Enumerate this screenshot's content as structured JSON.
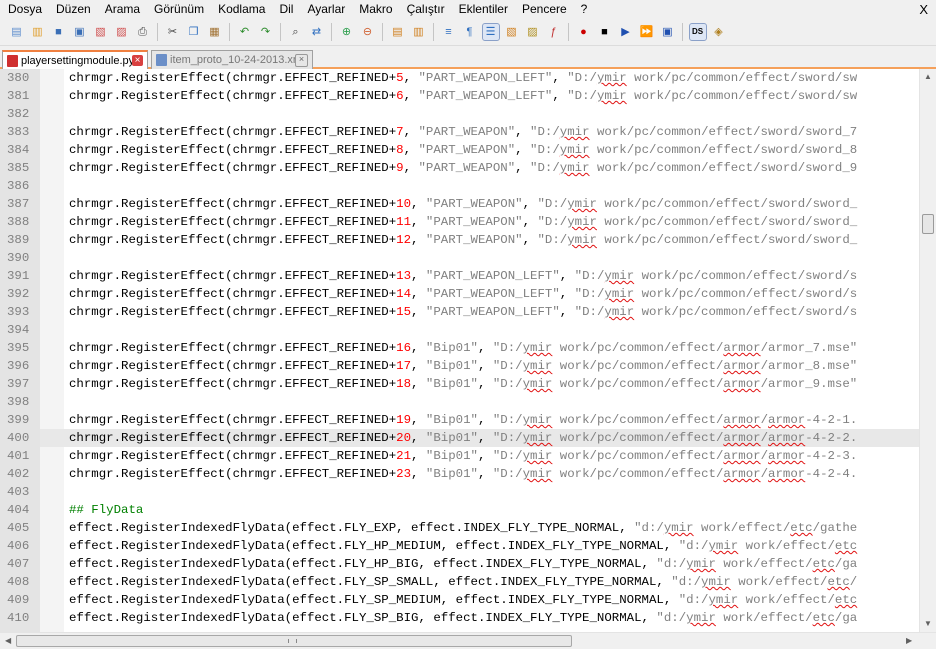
{
  "menu": [
    "Dosya",
    "Düzen",
    "Arama",
    "Görünüm",
    "Kodlama",
    "Dil",
    "Ayarlar",
    "Makro",
    "Çalıştır",
    "Eklentiler",
    "Pencere",
    "?"
  ],
  "window": {
    "close_glyph": "X"
  },
  "toolbar": {
    "icons": [
      {
        "name": "new-file-icon",
        "glyph": "▤",
        "color": "#5b8ccd"
      },
      {
        "name": "open-file-icon",
        "glyph": "▥",
        "color": "#e0a030"
      },
      {
        "name": "save-icon",
        "glyph": "■",
        "color": "#3b6fb6"
      },
      {
        "name": "save-all-icon",
        "glyph": "▣",
        "color": "#3b6fb6"
      },
      {
        "name": "close-file-icon",
        "glyph": "▧",
        "color": "#d05050"
      },
      {
        "name": "close-all-icon",
        "glyph": "▨",
        "color": "#d05050"
      },
      {
        "name": "print-icon",
        "glyph": "⎙",
        "color": "#505050"
      },
      {
        "sep": true
      },
      {
        "name": "cut-icon",
        "glyph": "✂",
        "color": "#404040"
      },
      {
        "name": "copy-icon",
        "glyph": "❐",
        "color": "#3070c0"
      },
      {
        "name": "paste-icon",
        "glyph": "▦",
        "color": "#a07030"
      },
      {
        "sep": true
      },
      {
        "name": "undo-icon",
        "glyph": "↶",
        "color": "#2a8a2a"
      },
      {
        "name": "redo-icon",
        "glyph": "↷",
        "color": "#2a8a2a"
      },
      {
        "sep": true
      },
      {
        "name": "find-icon",
        "glyph": "⌕",
        "color": "#404040"
      },
      {
        "name": "replace-icon",
        "glyph": "⇄",
        "color": "#3070c0"
      },
      {
        "sep": true
      },
      {
        "name": "zoom-in-icon",
        "glyph": "⊕",
        "color": "#30a050"
      },
      {
        "name": "zoom-out-icon",
        "glyph": "⊖",
        "color": "#d06030"
      },
      {
        "sep": true
      },
      {
        "name": "sync-vertical-scroll-icon",
        "glyph": "▤",
        "color": "#d08020"
      },
      {
        "name": "sync-horizontal-scroll-icon",
        "glyph": "▥",
        "color": "#d08020"
      },
      {
        "sep": true
      },
      {
        "name": "word-wrap-icon",
        "glyph": "≡",
        "color": "#3070c0"
      },
      {
        "name": "show-all-characters-icon",
        "glyph": "¶",
        "color": "#3070c0"
      },
      {
        "name": "indent-guide-icon",
        "glyph": "☰",
        "color": "#3070c0",
        "selected": true
      },
      {
        "name": "user-defined-language-icon",
        "glyph": "▧",
        "color": "#d08020"
      },
      {
        "name": "document-map-icon",
        "glyph": "▨",
        "color": "#b09020"
      },
      {
        "name": "function-list-icon",
        "glyph": "ƒ",
        "color": "#c03030"
      },
      {
        "sep": true
      },
      {
        "name": "record-macro-icon",
        "glyph": "●",
        "color": "#cc0000"
      },
      {
        "name": "stop-recording-icon",
        "glyph": "■",
        "color": "#000000"
      },
      {
        "name": "playback-macro-icon",
        "glyph": "▶",
        "color": "#2050b0"
      },
      {
        "name": "run-macro-multiple-icon",
        "glyph": "⏩",
        "color": "#2050b0"
      },
      {
        "name": "save-macro-icon",
        "glyph": "▣",
        "color": "#2050b0"
      },
      {
        "sep": true
      },
      {
        "name": "ds-plugin-icon",
        "glyph": "DS",
        "color": "#000000",
        "selected": true
      },
      {
        "name": "plugin-icon",
        "glyph": "◈",
        "color": "#b08020"
      }
    ]
  },
  "tabs": [
    {
      "label": "playersettingmodule.py",
      "active": true,
      "icon_color": "#d03030"
    },
    {
      "label": "item_proto_10-24-2013.xml",
      "active": false,
      "icon_color": "#6b8fc8"
    }
  ],
  "colors": {
    "keyword_gray": "#808080",
    "number_red": "#ff0000",
    "comment_green": "#008000",
    "tab_accent": "#f08040"
  },
  "current_line": 400,
  "lines": [
    {
      "n": "380",
      "segs": [
        [
          "t",
          "chrmgr.RegisterEffect(chrmgr.EFFECT_REFINED+"
        ],
        [
          "n",
          "5"
        ],
        [
          "t",
          ", "
        ],
        [
          "s",
          "\"PART_WEAPON_LEFT\""
        ],
        [
          "t",
          ", "
        ],
        [
          "s",
          "\"D:/"
        ],
        [
          "u",
          "ymir"
        ],
        [
          "s",
          " work/pc/common/effect/sword/sw"
        ]
      ]
    },
    {
      "n": "381",
      "segs": [
        [
          "t",
          "chrmgr.RegisterEffect(chrmgr.EFFECT_REFINED+"
        ],
        [
          "n",
          "6"
        ],
        [
          "t",
          ", "
        ],
        [
          "s",
          "\"PART_WEAPON_LEFT\""
        ],
        [
          "t",
          ", "
        ],
        [
          "s",
          "\"D:/"
        ],
        [
          "u",
          "ymir"
        ],
        [
          "s",
          " work/pc/common/effect/sword/sw"
        ]
      ]
    },
    {
      "n": "382",
      "segs": []
    },
    {
      "n": "383",
      "segs": [
        [
          "t",
          "chrmgr.RegisterEffect(chrmgr.EFFECT_REFINED+"
        ],
        [
          "n",
          "7"
        ],
        [
          "t",
          ", "
        ],
        [
          "s",
          "\"PART_WEAPON\""
        ],
        [
          "t",
          ", "
        ],
        [
          "s",
          "\"D:/"
        ],
        [
          "u",
          "ymir"
        ],
        [
          "s",
          " work/pc/common/effect/sword/sword_7"
        ]
      ]
    },
    {
      "n": "384",
      "segs": [
        [
          "t",
          "chrmgr.RegisterEffect(chrmgr.EFFECT_REFINED+"
        ],
        [
          "n",
          "8"
        ],
        [
          "t",
          ", "
        ],
        [
          "s",
          "\"PART_WEAPON\""
        ],
        [
          "t",
          ", "
        ],
        [
          "s",
          "\"D:/"
        ],
        [
          "u",
          "ymir"
        ],
        [
          "s",
          " work/pc/common/effect/sword/sword_8"
        ]
      ]
    },
    {
      "n": "385",
      "segs": [
        [
          "t",
          "chrmgr.RegisterEffect(chrmgr.EFFECT_REFINED+"
        ],
        [
          "n",
          "9"
        ],
        [
          "t",
          ", "
        ],
        [
          "s",
          "\"PART_WEAPON\""
        ],
        [
          "t",
          ", "
        ],
        [
          "s",
          "\"D:/"
        ],
        [
          "u",
          "ymir"
        ],
        [
          "s",
          " work/pc/common/effect/sword/sword_9"
        ]
      ]
    },
    {
      "n": "386",
      "segs": []
    },
    {
      "n": "387",
      "segs": [
        [
          "t",
          "chrmgr.RegisterEffect(chrmgr.EFFECT_REFINED+"
        ],
        [
          "n",
          "10"
        ],
        [
          "t",
          ", "
        ],
        [
          "s",
          "\"PART_WEAPON\""
        ],
        [
          "t",
          ", "
        ],
        [
          "s",
          "\"D:/"
        ],
        [
          "u",
          "ymir"
        ],
        [
          "s",
          " work/pc/common/effect/sword/sword_"
        ]
      ]
    },
    {
      "n": "388",
      "segs": [
        [
          "t",
          "chrmgr.RegisterEffect(chrmgr.EFFECT_REFINED+"
        ],
        [
          "n",
          "11"
        ],
        [
          "t",
          ", "
        ],
        [
          "s",
          "\"PART_WEAPON\""
        ],
        [
          "t",
          ", "
        ],
        [
          "s",
          "\"D:/"
        ],
        [
          "u",
          "ymir"
        ],
        [
          "s",
          " work/pc/common/effect/sword/sword_"
        ]
      ]
    },
    {
      "n": "389",
      "segs": [
        [
          "t",
          "chrmgr.RegisterEffect(chrmgr.EFFECT_REFINED+"
        ],
        [
          "n",
          "12"
        ],
        [
          "t",
          ", "
        ],
        [
          "s",
          "\"PART_WEAPON\""
        ],
        [
          "t",
          ", "
        ],
        [
          "s",
          "\"D:/"
        ],
        [
          "u",
          "ymir"
        ],
        [
          "s",
          " work/pc/common/effect/sword/sword_"
        ]
      ]
    },
    {
      "n": "390",
      "segs": []
    },
    {
      "n": "391",
      "segs": [
        [
          "t",
          "chrmgr.RegisterEffect(chrmgr.EFFECT_REFINED+"
        ],
        [
          "n",
          "13"
        ],
        [
          "t",
          ", "
        ],
        [
          "s",
          "\"PART_WEAPON_LEFT\""
        ],
        [
          "t",
          ", "
        ],
        [
          "s",
          "\"D:/"
        ],
        [
          "u",
          "ymir"
        ],
        [
          "s",
          " work/pc/common/effect/sword/s"
        ]
      ]
    },
    {
      "n": "392",
      "segs": [
        [
          "t",
          "chrmgr.RegisterEffect(chrmgr.EFFECT_REFINED+"
        ],
        [
          "n",
          "14"
        ],
        [
          "t",
          ", "
        ],
        [
          "s",
          "\"PART_WEAPON_LEFT\""
        ],
        [
          "t",
          ", "
        ],
        [
          "s",
          "\"D:/"
        ],
        [
          "u",
          "ymir"
        ],
        [
          "s",
          " work/pc/common/effect/sword/s"
        ]
      ]
    },
    {
      "n": "393",
      "segs": [
        [
          "t",
          "chrmgr.RegisterEffect(chrmgr.EFFECT_REFINED+"
        ],
        [
          "n",
          "15"
        ],
        [
          "t",
          ", "
        ],
        [
          "s",
          "\"PART_WEAPON_LEFT\""
        ],
        [
          "t",
          ", "
        ],
        [
          "s",
          "\"D:/"
        ],
        [
          "u",
          "ymir"
        ],
        [
          "s",
          " work/pc/common/effect/sword/s"
        ]
      ]
    },
    {
      "n": "394",
      "segs": []
    },
    {
      "n": "395",
      "segs": [
        [
          "t",
          "chrmgr.RegisterEffect(chrmgr.EFFECT_REFINED+"
        ],
        [
          "n",
          "16"
        ],
        [
          "t",
          ", "
        ],
        [
          "s",
          "\"Bip01\""
        ],
        [
          "t",
          ", "
        ],
        [
          "s",
          "\"D:/"
        ],
        [
          "u",
          "ymir"
        ],
        [
          "s",
          " work/pc/common/effect/"
        ],
        [
          "u",
          "armor"
        ],
        [
          "s",
          "/armor_7.mse\""
        ]
      ]
    },
    {
      "n": "396",
      "segs": [
        [
          "t",
          "chrmgr.RegisterEffect(chrmgr.EFFECT_REFINED+"
        ],
        [
          "n",
          "17"
        ],
        [
          "t",
          ", "
        ],
        [
          "s",
          "\"Bip01\""
        ],
        [
          "t",
          ", "
        ],
        [
          "s",
          "\"D:/"
        ],
        [
          "u",
          "ymir"
        ],
        [
          "s",
          " work/pc/common/effect/"
        ],
        [
          "u",
          "armor"
        ],
        [
          "s",
          "/armor_8.mse\""
        ]
      ]
    },
    {
      "n": "397",
      "segs": [
        [
          "t",
          "chrmgr.RegisterEffect(chrmgr.EFFECT_REFINED+"
        ],
        [
          "n",
          "18"
        ],
        [
          "t",
          ", "
        ],
        [
          "s",
          "\"Bip01\""
        ],
        [
          "t",
          ", "
        ],
        [
          "s",
          "\"D:/"
        ],
        [
          "u",
          "ymir"
        ],
        [
          "s",
          " work/pc/common/effect/"
        ],
        [
          "u",
          "armor"
        ],
        [
          "s",
          "/armor_9.mse\""
        ]
      ]
    },
    {
      "n": "398",
      "segs": []
    },
    {
      "n": "399",
      "segs": [
        [
          "t",
          "chrmgr.RegisterEffect(chrmgr.EFFECT_REFINED+"
        ],
        [
          "n",
          "19"
        ],
        [
          "t",
          ", "
        ],
        [
          "s",
          "\"Bip01\""
        ],
        [
          "t",
          ", "
        ],
        [
          "s",
          "\"D:/"
        ],
        [
          "u",
          "ymir"
        ],
        [
          "s",
          " work/pc/common/effect/"
        ],
        [
          "u",
          "armor"
        ],
        [
          "s",
          "/"
        ],
        [
          "u",
          "armor"
        ],
        [
          "s",
          "-4-2-1."
        ]
      ]
    },
    {
      "n": "400",
      "segs": [
        [
          "t",
          "chrmgr.RegisterEffect(chrmgr.EFFECT_REFINED+"
        ],
        [
          "n",
          "20"
        ],
        [
          "t",
          ", "
        ],
        [
          "s",
          "\"Bip01\""
        ],
        [
          "t",
          ", "
        ],
        [
          "s",
          "\"D:/"
        ],
        [
          "u",
          "ymir"
        ],
        [
          "s",
          " work/pc/common/effect/"
        ],
        [
          "u",
          "armor"
        ],
        [
          "s",
          "/"
        ],
        [
          "u",
          "armor"
        ],
        [
          "s",
          "-4-2-2."
        ]
      ]
    },
    {
      "n": "401",
      "segs": [
        [
          "t",
          "chrmgr.RegisterEffect(chrmgr.EFFECT_REFINED+"
        ],
        [
          "n",
          "21"
        ],
        [
          "t",
          ", "
        ],
        [
          "s",
          "\"Bip01\""
        ],
        [
          "t",
          ", "
        ],
        [
          "s",
          "\"D:/"
        ],
        [
          "u",
          "ymir"
        ],
        [
          "s",
          " work/pc/common/effect/"
        ],
        [
          "u",
          "armor"
        ],
        [
          "s",
          "/"
        ],
        [
          "u",
          "armor"
        ],
        [
          "s",
          "-4-2-3."
        ]
      ]
    },
    {
      "n": "402",
      "segs": [
        [
          "t",
          "chrmgr.RegisterEffect(chrmgr.EFFECT_REFINED+"
        ],
        [
          "n",
          "23"
        ],
        [
          "t",
          ", "
        ],
        [
          "s",
          "\"Bip01\""
        ],
        [
          "t",
          ", "
        ],
        [
          "s",
          "\"D:/"
        ],
        [
          "u",
          "ymir"
        ],
        [
          "s",
          " work/pc/common/effect/"
        ],
        [
          "u",
          "armor"
        ],
        [
          "s",
          "/"
        ],
        [
          "u",
          "armor"
        ],
        [
          "s",
          "-4-2-4."
        ]
      ]
    },
    {
      "n": "403",
      "segs": []
    },
    {
      "n": "404",
      "segs": [
        [
          "c",
          "## FlyData"
        ]
      ]
    },
    {
      "n": "405",
      "segs": [
        [
          "t",
          "effect.RegisterIndexedFlyData(effect.FLY_EXP, effect.INDEX_FLY_TYPE_NORMAL, "
        ],
        [
          "s",
          "\"d:/"
        ],
        [
          "u",
          "ymir"
        ],
        [
          "s",
          " work/effect/"
        ],
        [
          "u",
          "etc"
        ],
        [
          "s",
          "/gathe"
        ]
      ]
    },
    {
      "n": "406",
      "segs": [
        [
          "t",
          "effect.RegisterIndexedFlyData(effect.FLY_HP_MEDIUM, effect.INDEX_FLY_TYPE_NORMAL, "
        ],
        [
          "s",
          "\"d:/"
        ],
        [
          "u",
          "ymir"
        ],
        [
          "s",
          " work/effect/"
        ],
        [
          "u",
          "etc"
        ]
      ]
    },
    {
      "n": "407",
      "segs": [
        [
          "t",
          "effect.RegisterIndexedFlyData(effect.FLY_HP_BIG, effect.INDEX_FLY_TYPE_NORMAL, "
        ],
        [
          "s",
          "\"d:/"
        ],
        [
          "u",
          "ymir"
        ],
        [
          "s",
          " work/effect/"
        ],
        [
          "u",
          "etc"
        ],
        [
          "s",
          "/ga"
        ]
      ]
    },
    {
      "n": "408",
      "segs": [
        [
          "t",
          "effect.RegisterIndexedFlyData(effect.FLY_SP_SMALL, effect.INDEX_FLY_TYPE_NORMAL, "
        ],
        [
          "s",
          "\"d:/"
        ],
        [
          "u",
          "ymir"
        ],
        [
          "s",
          " work/effect/"
        ],
        [
          "u",
          "etc"
        ],
        [
          "s",
          "/"
        ]
      ]
    },
    {
      "n": "409",
      "segs": [
        [
          "t",
          "effect.RegisterIndexedFlyData(effect.FLY_SP_MEDIUM, effect.INDEX_FLY_TYPE_NORMAL, "
        ],
        [
          "s",
          "\"d:/"
        ],
        [
          "u",
          "ymir"
        ],
        [
          "s",
          " work/effect/"
        ],
        [
          "u",
          "etc"
        ]
      ]
    },
    {
      "n": "410",
      "segs": [
        [
          "t",
          "effect.RegisterIndexedFlyData(effect.FLY_SP_BIG, effect.INDEX_FLY_TYPE_NORMAL, "
        ],
        [
          "s",
          "\"d:/"
        ],
        [
          "u",
          "ymir"
        ],
        [
          "s",
          " work/effect/"
        ],
        [
          "u",
          "etc"
        ],
        [
          "s",
          "/ga"
        ]
      ]
    }
  ]
}
